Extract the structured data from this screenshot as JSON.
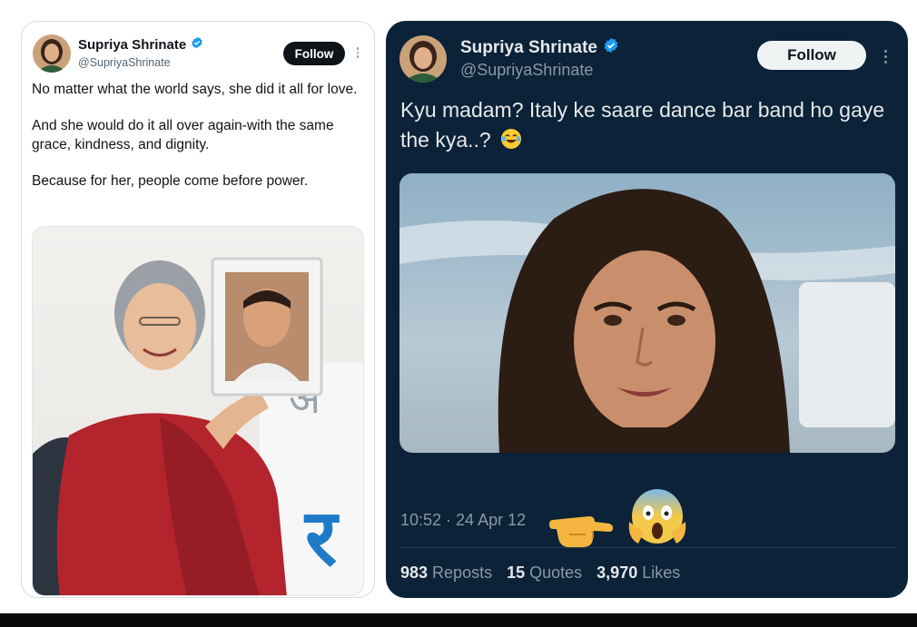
{
  "left_tweet": {
    "author_name": "Supriya Shrinate",
    "author_handle": "@SupriyaShrinate",
    "follow_label": "Follow",
    "paragraphs": [
      "No matter what the world says, she did it all for love.",
      "And she would do it all over again-with the same grace, kindness, and dignity.",
      "Because for her, people come before power."
    ],
    "photo_sign_text": [
      "अ",
      "र"
    ]
  },
  "right_tweet": {
    "author_name": "Supriya Shrinate",
    "author_handle": "@SupriyaShrinate",
    "follow_label": "Follow",
    "text": "Kyu madam? Italy ke saare dance bar band ho gaye the kya..?",
    "text_emoji": "laughing-tears-emoji",
    "timestamp": "10:52 · 24 Apr 12",
    "stats": {
      "reposts_count": "983",
      "reposts_label": "Reposts",
      "quotes_count": "15",
      "quotes_label": "Quotes",
      "likes_count": "3,970",
      "likes_label": "Likes"
    }
  },
  "colors": {
    "verified_blue": "#1d9bf0",
    "dark_card_bg": "#0b2238",
    "light_text": "#0f1419",
    "muted_text": "#536471",
    "dark_muted_text": "#8b98a5"
  }
}
